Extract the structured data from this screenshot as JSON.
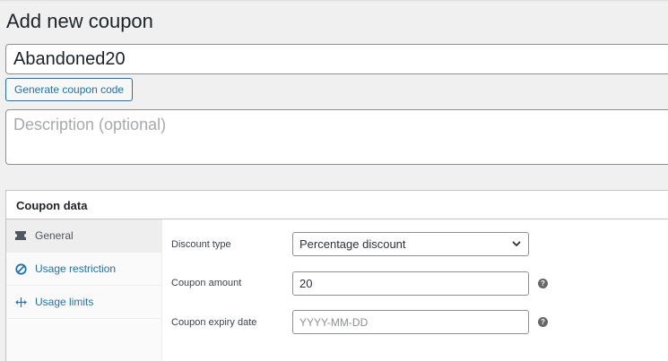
{
  "page": {
    "title": "Add new coupon"
  },
  "coupon_code": {
    "value": "Abandoned20"
  },
  "generate_button": {
    "label": "Generate coupon code"
  },
  "description": {
    "placeholder": "Description (optional)"
  },
  "coupon_data": {
    "header": "Coupon data",
    "tabs": [
      {
        "label": "General",
        "icon": "ticket-icon",
        "active": true
      },
      {
        "label": "Usage restriction",
        "icon": "block-icon",
        "active": false
      },
      {
        "label": "Usage limits",
        "icon": "limits-icon",
        "active": false
      }
    ],
    "fields": {
      "discount_type": {
        "label": "Discount type",
        "selected": "Percentage discount"
      },
      "coupon_amount": {
        "label": "Coupon amount",
        "value": "20",
        "help": "?"
      },
      "expiry_date": {
        "label": "Coupon expiry date",
        "placeholder": "YYYY-MM-DD",
        "help": "?"
      }
    }
  },
  "colors": {
    "accent": "#2271b1",
    "background": "#f0f0f1",
    "border": "#8c8f94"
  }
}
